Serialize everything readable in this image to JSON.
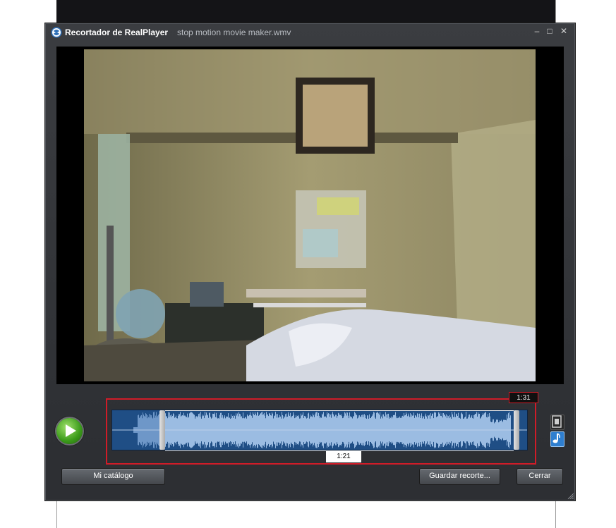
{
  "window": {
    "app_title": "Recortador de RealPlayer",
    "file_name": "stop motion movie maker.wmv",
    "minimize_glyph": "–",
    "maximize_glyph": "□",
    "close_glyph": "✕"
  },
  "timeline": {
    "end_time": "1:31",
    "selection_duration": "1:21",
    "selection_start_fraction": 0.12,
    "selection_end_fraction": 0.985
  },
  "buttons": {
    "catalog": "Mi catálogo",
    "save_clip": "Guardar recorte...",
    "close": "Cerrar"
  },
  "icons": {
    "app": "realplayer-logo-icon",
    "play": "play-icon",
    "video_mode": "film-strip-icon",
    "audio_mode": "music-note-icon",
    "resize": "resize-grip-icon"
  },
  "colors": {
    "accent_red": "#d01c28",
    "waveform_bg": "#1f4e85",
    "waveform_fg": "#8fb3dd",
    "play_green": "#3a9a1a"
  }
}
